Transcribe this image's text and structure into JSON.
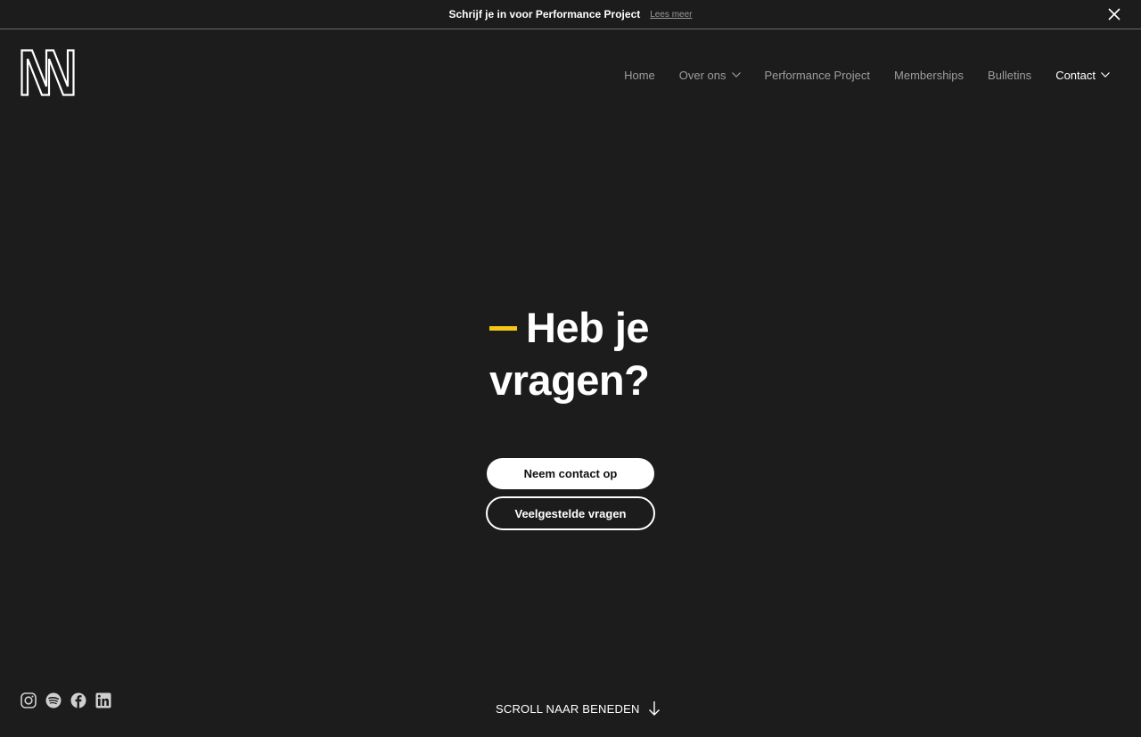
{
  "announcement": {
    "text": "Schrijf je in voor Performance Project",
    "link": "Lees meer"
  },
  "nav": {
    "items": [
      {
        "label": "Home"
      },
      {
        "label": "Over ons"
      },
      {
        "label": "Performance Project"
      },
      {
        "label": "Memberships"
      },
      {
        "label": "Bulletins"
      },
      {
        "label": "Contact"
      }
    ]
  },
  "hero": {
    "title_line1": "Heb je",
    "title_line2": "vragen?",
    "primary_button": "Neem contact op",
    "secondary_button": "Veelgestelde vragen"
  },
  "scroll": {
    "label": "SCROLL NAAR BENEDEN"
  },
  "socials": [
    "instagram-icon",
    "spotify-icon",
    "facebook-icon",
    "linkedin-icon"
  ],
  "colors": {
    "background": "#1c1c1c",
    "accent": "#f5c518",
    "nav_inactive": "#9d9d9d",
    "text": "#ffffff"
  }
}
